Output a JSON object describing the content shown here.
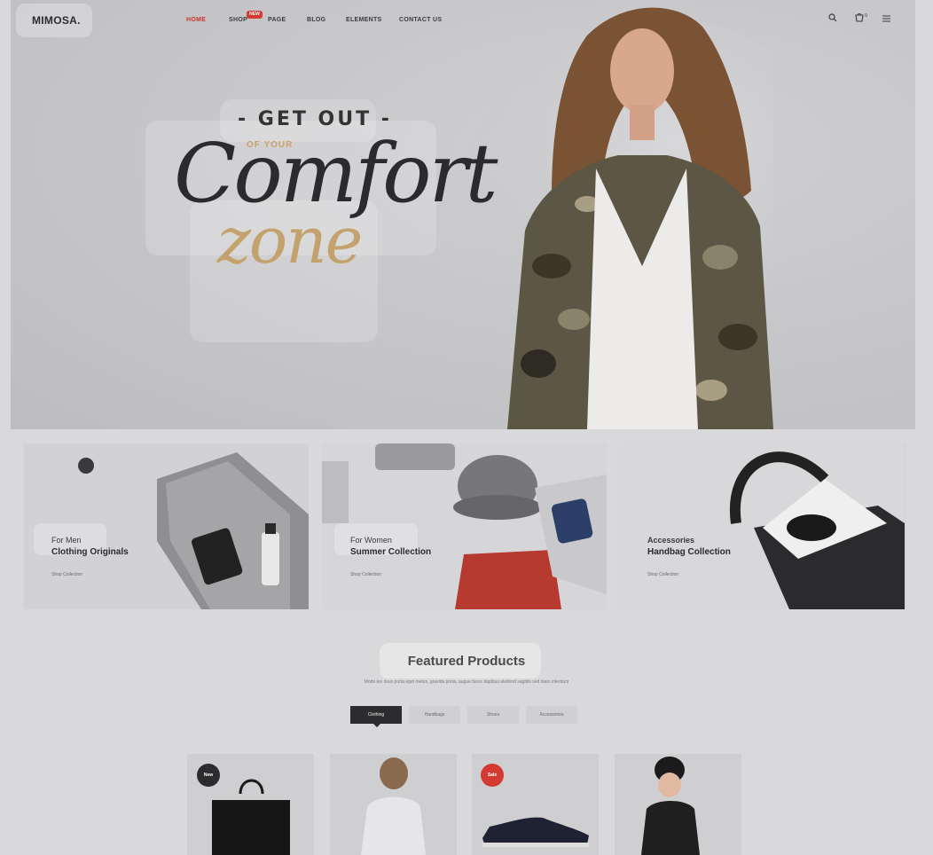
{
  "header": {
    "logo": "MIMOSA.",
    "nav": [
      {
        "label": "HOME",
        "active": true
      },
      {
        "label": "SHOP",
        "active": false
      },
      {
        "label": "PAGE",
        "active": false
      },
      {
        "label": "BLOG",
        "active": false
      },
      {
        "label": "ELEMENTS",
        "active": false
      },
      {
        "label": "CONTACT US",
        "active": false
      }
    ],
    "shop_badge": "NEW",
    "icons": [
      "search-icon",
      "cart-icon",
      "menu-icon"
    ],
    "cart_count": "0"
  },
  "hero": {
    "line1": "- GET OUT -",
    "line2": "OF YOUR",
    "line3": "Comfort",
    "line4": "zone"
  },
  "collections": [
    {
      "subtitle": "For Men",
      "title": "Clothing Originals",
      "link": "Shop Collection"
    },
    {
      "subtitle": "For Women",
      "title": "Summer Collection",
      "link": "Shop Collection"
    },
    {
      "subtitle": "Accessories",
      "title": "Handbag Collection",
      "link": "Shop Collection"
    }
  ],
  "featured": {
    "title": "Featured Products",
    "description": "Morbi leo risus porta eget metus, gravida porta, augue fusce dapibus eleifend sagittis sed diam interdum",
    "tabs": [
      {
        "label": "Clothing",
        "active": true
      },
      {
        "label": "Handbags",
        "active": false
      },
      {
        "label": "Shoes",
        "active": false
      },
      {
        "label": "Accessories",
        "active": false
      }
    ],
    "products": [
      {
        "badge": "New",
        "badge_color": "#2c2c2e"
      },
      {
        "badge": "",
        "badge_color": ""
      },
      {
        "badge": "Sale",
        "badge_color": "#d23a32"
      },
      {
        "badge": "",
        "badge_color": ""
      }
    ]
  },
  "colors": {
    "accent": "#d23a32",
    "gold": "#c4a26d",
    "dark": "#2c2c2e"
  }
}
